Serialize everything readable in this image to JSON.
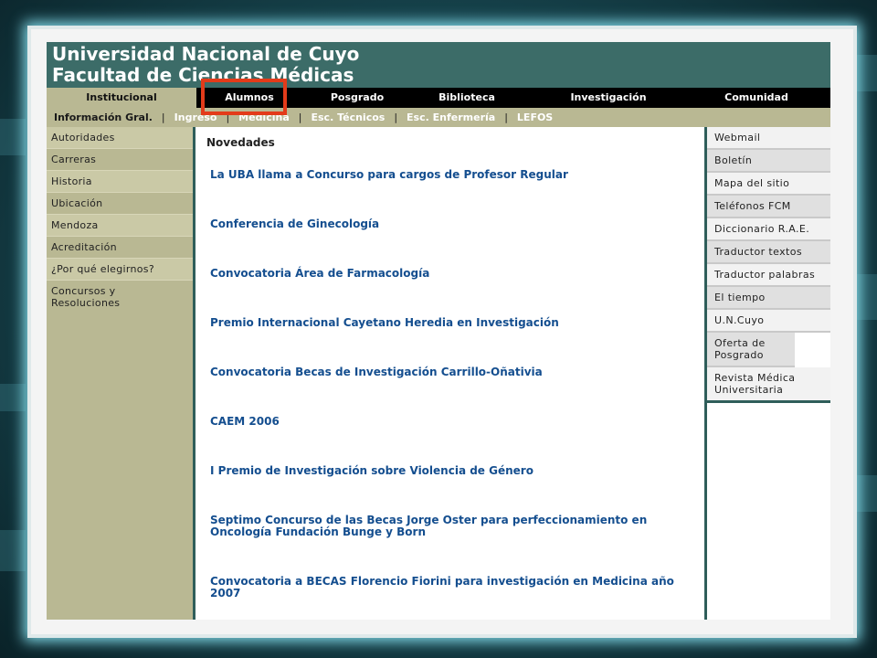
{
  "header": {
    "line1": "Universidad Nacional de Cuyo",
    "line2": "Facultad de Ciencias Médicas"
  },
  "main_nav": [
    "Institucional",
    "Alumnos",
    "Posgrado",
    "Biblioteca",
    "Investigación",
    "Comunidad"
  ],
  "main_nav_active": "Institucional",
  "sub_nav": [
    "Información Gral.",
    "Ingreso",
    "Medicina",
    "Esc. Técnicos",
    "Esc. Enfermería",
    "LEFOS"
  ],
  "sub_nav_separator": "|",
  "left_menu": [
    "Autoridades",
    "Carreras",
    "Historia",
    "Ubicación",
    "Mendoza",
    "Acreditación",
    "¿Por qué elegirnos?",
    "Concursos y Resoluciones"
  ],
  "center": {
    "heading": "Novedades",
    "news": [
      "La UBA llama a Concurso para cargos de Profesor Regular",
      "Conferencia de Ginecología",
      "Convocatoria Área de Farmacología",
      "Premio Internacional Cayetano Heredia en Investigación",
      "Convocatoria Becas de Investigación Carrillo-Oñativia",
      "CAEM 2006",
      "I Premio de Investigación sobre Violencia de Género",
      "Septimo Concurso de las Becas Jorge Oster para perfeccionamiento en Oncología Fundación Bunge y Born",
      "Convocatoria a BECAS Florencio Fiorini para investigación en Medicina año 2007"
    ]
  },
  "right_menu": [
    "Webmail",
    "Boletín",
    "Mapa del sitio",
    "Teléfonos FCM",
    "Diccionario R.A.E.",
    "Traductor textos",
    "Traductor palabras",
    "El tiempo",
    "U.N.Cuyo",
    "Oferta de Posgrado",
    "Revista Médica Universitaria"
  ],
  "colors": {
    "header_bg": "#3c6c68",
    "nav_bg": "#000000",
    "olive": "#b9b893",
    "link": "#144e8f",
    "highlight": "#e33b1a"
  }
}
